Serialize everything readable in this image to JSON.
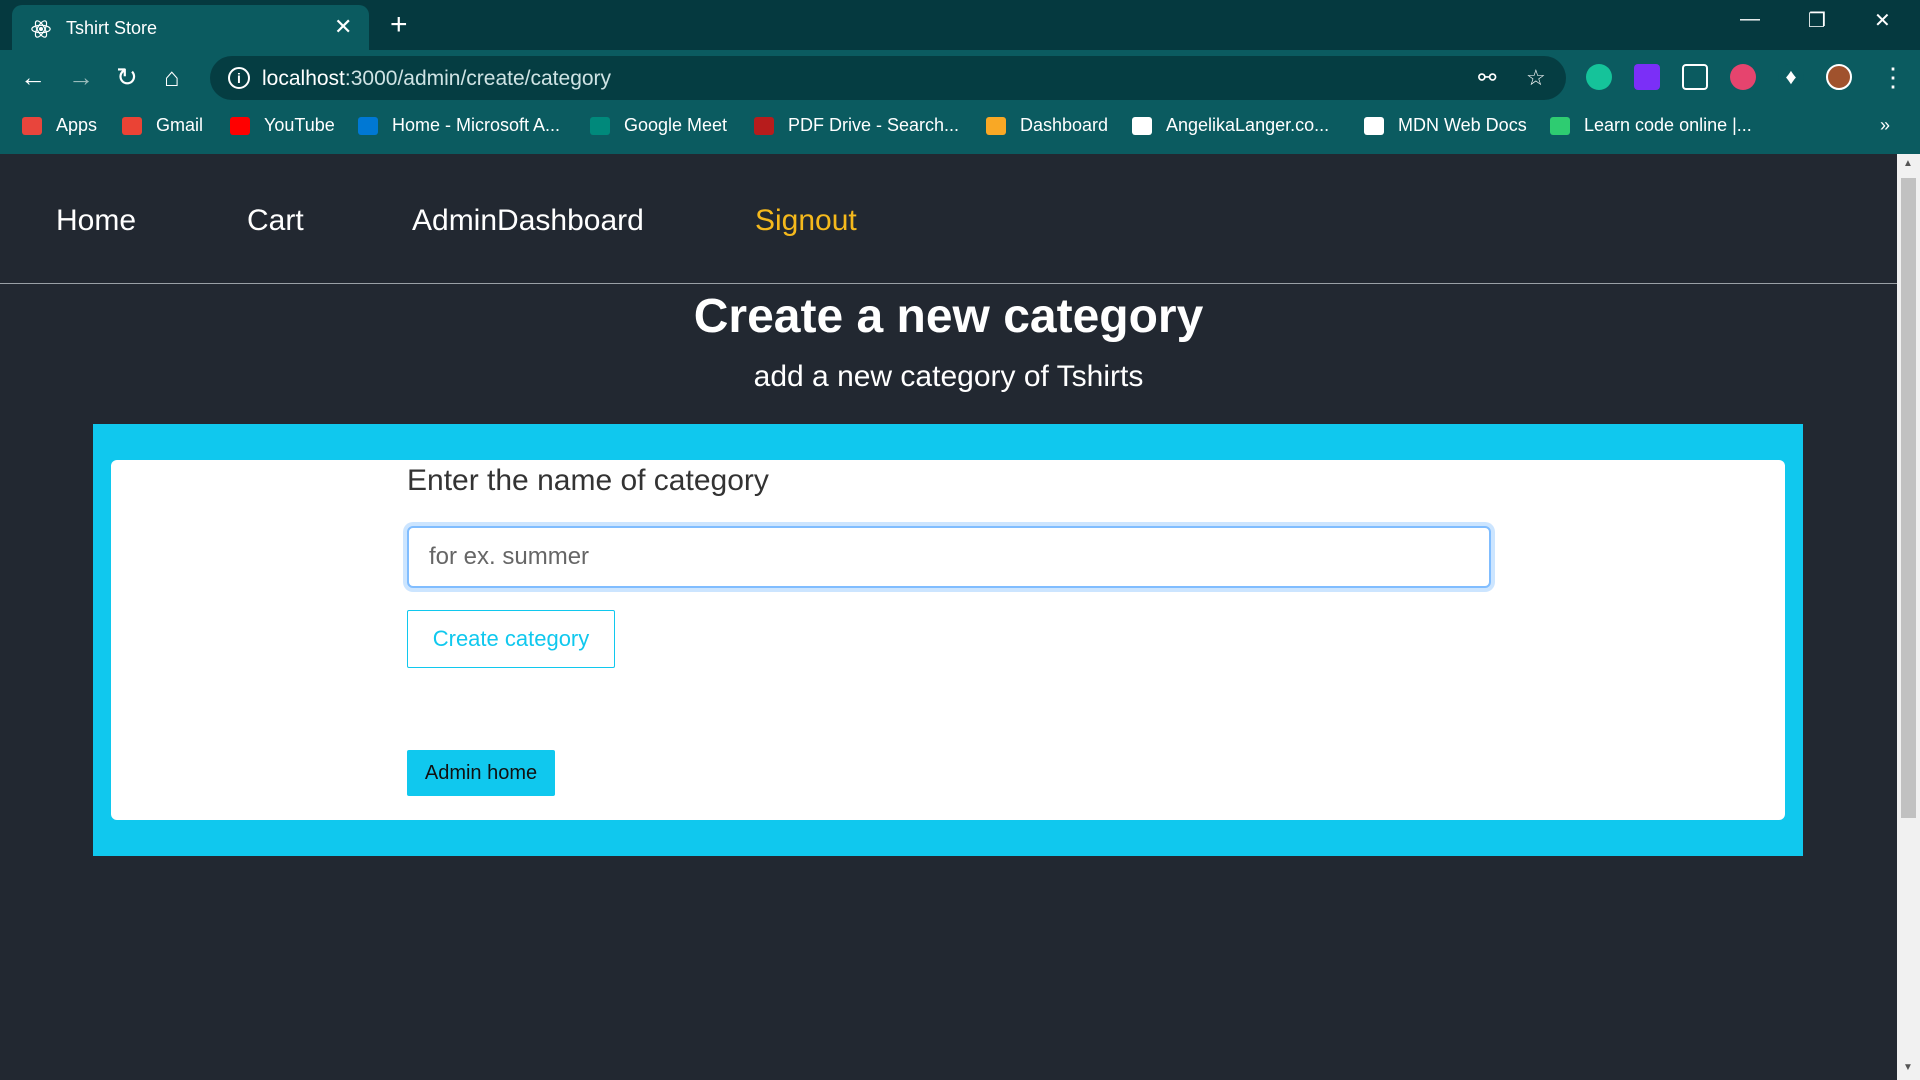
{
  "browser": {
    "tab_title": "Tshirt Store",
    "tab_close": "✕",
    "new_tab": "+",
    "url_host": "localhost",
    "url_path": ":3000/admin/create/category",
    "bookmarks": [
      {
        "label": "Apps",
        "color": "#e8453c"
      },
      {
        "label": "Gmail",
        "color": "#ea4335"
      },
      {
        "label": "YouTube",
        "color": "#ff0000"
      },
      {
        "label": "Home - Microsoft A...",
        "color": "#0078d4"
      },
      {
        "label": "Google Meet",
        "color": "#00897b"
      },
      {
        "label": "PDF Drive - Search...",
        "color": "#b71c1c"
      },
      {
        "label": "Dashboard",
        "color": "#f9a825"
      },
      {
        "label": "AngelikaLanger.co...",
        "color": "#ffffff"
      },
      {
        "label": "MDN Web Docs",
        "color": "#ffffff"
      },
      {
        "label": "Learn code online |...",
        "color": "#2ecc71"
      }
    ],
    "more": "»"
  },
  "site_nav": {
    "home": "Home",
    "cart": "Cart",
    "admin_dashboard": "AdminDashboard",
    "signout": "Signout"
  },
  "main": {
    "title": "Create a new category",
    "description": "add a new category of Tshirts",
    "form": {
      "label": "Enter the name of category",
      "placeholder": "for ex. summer",
      "submit_label": "Create category",
      "admin_home_label": "Admin home"
    }
  },
  "colors": {
    "accent": "#10c8ee",
    "signout": "#f5b91c",
    "page_bg": "#222831"
  }
}
